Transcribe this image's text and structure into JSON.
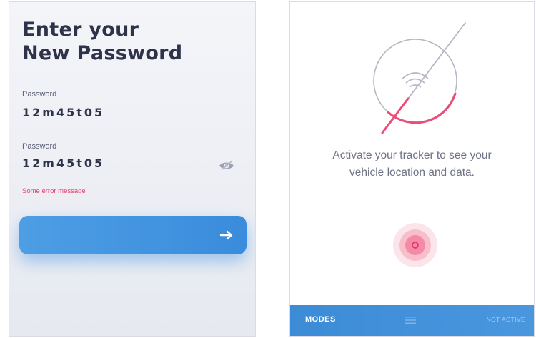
{
  "password_screen": {
    "title_line1": "Enter your",
    "title_line2": "New Password",
    "fields": [
      {
        "label": "Password",
        "value": "12m45t05"
      },
      {
        "label": "Password",
        "value": "12m45t05"
      }
    ],
    "error_message": "Some error message",
    "submit_icon": "arrow-right-icon",
    "visibility_icon": "eye-off-icon"
  },
  "tracker_screen": {
    "message_line1": "Activate your tracker to see your",
    "message_line2": "vehicle location and data.",
    "graphic_icon": "signal-off-icon",
    "activate_icon": "power-icon",
    "bottom_bar": {
      "modes_label": "MODES",
      "menu_icon": "menu-icon",
      "status_label": "NOT ACTIVE"
    }
  },
  "colors": {
    "accent_blue": "#3d8fdc",
    "error_pink": "#e4406e",
    "title_text": "#2f3349"
  }
}
